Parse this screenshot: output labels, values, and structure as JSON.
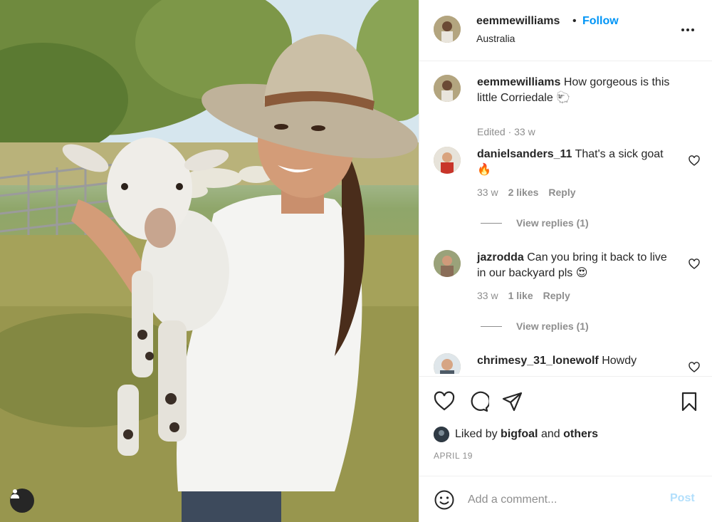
{
  "header": {
    "username": "eemmewilliams",
    "separator": "•",
    "follow_label": "Follow",
    "location": "Australia"
  },
  "caption": {
    "username": "eemmewilliams",
    "text": "How gorgeous is this little Corriedale 🐑",
    "meta": "Edited · 33 w"
  },
  "comments": [
    {
      "username": "danielsanders_11",
      "text": "That's a sick goat 🔥",
      "time": "33 w",
      "likes": "2 likes",
      "reply_label": "Reply",
      "view_replies": "View replies (1)"
    },
    {
      "username": "jazrodda",
      "text": "Can you bring it back to live in our backyard pls 😍",
      "time": "33 w",
      "likes": "1 like",
      "reply_label": "Reply",
      "view_replies": "View replies (1)"
    },
    {
      "username": "chrimesy_31_lonewolf",
      "text": "Howdy"
    }
  ],
  "liked_by": {
    "prefix": "Liked by",
    "user": "bigfoal",
    "and": "and",
    "others": "others"
  },
  "post_date": "APRIL 19",
  "add_comment": {
    "placeholder": "Add a comment...",
    "post_label": "Post"
  },
  "colors": {
    "link_blue": "#0095f6",
    "post_disabled": "#b2dffc",
    "muted_text": "#8e8e8e",
    "divider": "#efefef"
  },
  "icons": {
    "like": "heart-icon",
    "comment": "comment-bubble-icon",
    "share": "paper-plane-icon",
    "save": "bookmark-icon",
    "more": "more-options-icon",
    "emoji": "smiley-icon",
    "user_tag": "user-tag-icon"
  }
}
